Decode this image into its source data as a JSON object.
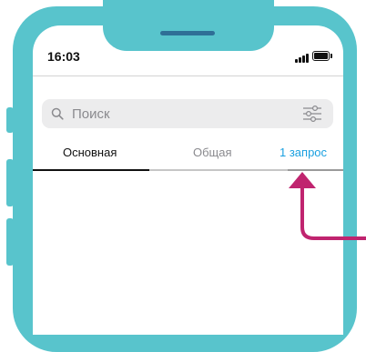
{
  "status_bar": {
    "time": "16:03"
  },
  "search": {
    "placeholder": "Поиск"
  },
  "tabs": [
    {
      "label": "Основная",
      "color": "#111111",
      "active": true
    },
    {
      "label": "Общая",
      "color": "#8a8a8e",
      "active": false
    },
    {
      "label": "1 запрос",
      "color": "#1aa0e0",
      "active": false
    }
  ],
  "colors": {
    "frame": "#58c4cc",
    "arrow": "#c0246f",
    "accent": "#1aa0e0"
  }
}
